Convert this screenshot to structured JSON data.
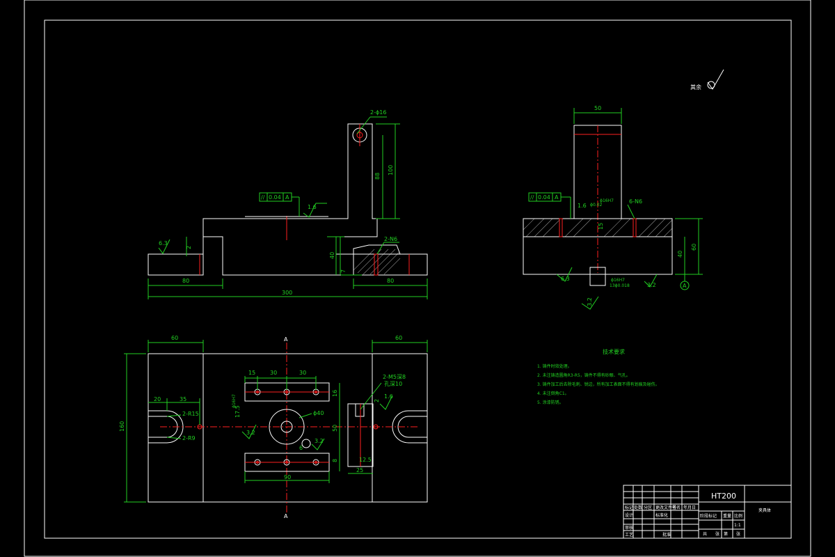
{
  "drawing": {
    "material": "HT200",
    "part_name": "夹具体",
    "roughness_other_label": "其余",
    "tech_req_title": "技术要求",
    "tech_req_items": [
      "1. 铸件时效处理。",
      "2. 未注铸造圆角R3-R5，铸件不得有砂眼、气孔。",
      "3. 铸件加工后去除毛刺、锐边，所有加工表面不得有划痕及碰伤。",
      "4. 未注倒角C1。",
      "5. 涂漆防锈。"
    ],
    "front_view": {
      "tolerance_symbol": "//",
      "tolerance_value": "0.04",
      "datum": "A",
      "hole_label": "2-ϕ16",
      "slot_label": "2-N6",
      "dims": [
        "80",
        "300",
        "80",
        "88",
        "100",
        "40",
        "2",
        "7"
      ],
      "roughness": [
        "6.3",
        "1.6"
      ]
    },
    "side_view": {
      "tolerance_symbol": "//",
      "tolerance_value": "0.04",
      "datum": "A",
      "dims": [
        "50",
        "60",
        "40",
        "15"
      ],
      "notes": [
        "6-N6",
        "ϕ16H7",
        "ϕ0.02",
        "1.6"
      ],
      "roughness": [
        "6.3",
        "3.2",
        "3.2"
      ],
      "datum_label": "A",
      "bottom_labels": [
        "ϕ16H7",
        "13ϕ0.018"
      ]
    },
    "top_view": {
      "section_label": "A",
      "dims": [
        "60",
        "60",
        "160",
        "20",
        "35",
        "15",
        "30",
        "30",
        "16",
        "50",
        "8",
        "90",
        "12.5",
        "25",
        "2",
        "17.5",
        "6"
      ],
      "notes": [
        "2-R15",
        "2-R9",
        "ϕ40",
        "3.2",
        "3.2",
        "2-M5深8",
        "孔深10",
        "1.6",
        "ϕ16H7"
      ]
    },
    "title_block": {
      "cells": [
        "标记",
        "处数",
        "分区",
        "更改文件号",
        "签名",
        "年月日",
        "设计",
        "审核",
        "工艺",
        "标准化",
        "批准",
        "阶段标记",
        "重量",
        "比例",
        "共",
        "张",
        "第",
        "张",
        "1:1"
      ]
    }
  }
}
